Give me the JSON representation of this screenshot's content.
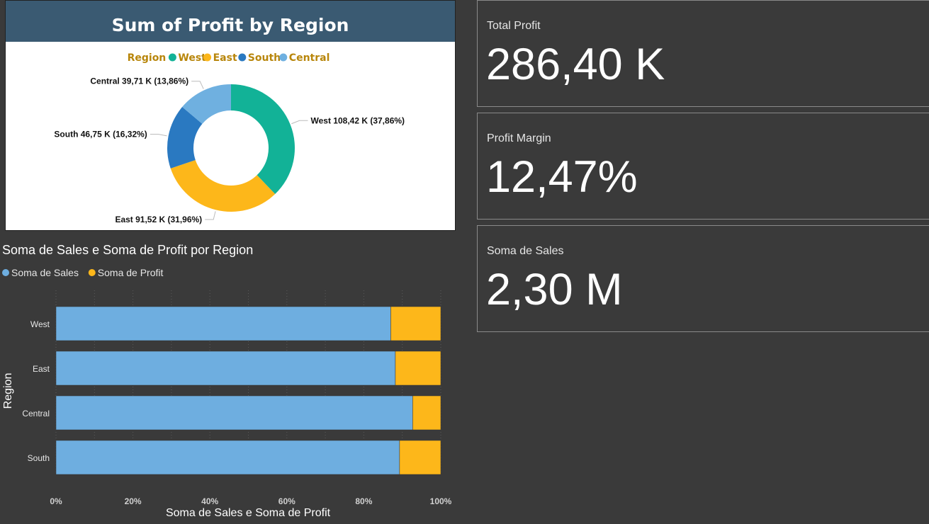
{
  "donut": {
    "title": "Sum of Profit by Region",
    "legend_title": "Region",
    "colors": {
      "title_bar": "#3a5a72",
      "legend_text": "#b8860b"
    }
  },
  "bar": {
    "title": "Soma de Sales e Soma de Profit por Region",
    "xlabel": "Soma de Sales e Soma de Profit",
    "ylabel": "Region"
  },
  "kpis": [
    {
      "label": "Total Profit",
      "value": "286,40 K"
    },
    {
      "label": "Profit Margin",
      "value": "12,47%"
    },
    {
      "label": "Soma de Sales",
      "value": "2,30 M"
    }
  ],
  "chart_data": [
    {
      "type": "pie",
      "title": "Sum of Profit by Region",
      "legend_title": "Region",
      "legend_position": "top",
      "donut": true,
      "categories": [
        "West",
        "East",
        "South",
        "Central"
      ],
      "values": [
        108.42,
        91.52,
        46.75,
        39.71
      ],
      "percents": [
        37.86,
        31.96,
        16.32,
        13.86
      ],
      "data_labels": [
        "West 108,42 K (37,86%)",
        "East 91,52 K (31,96%)",
        "South 46,75 K (16,32%)",
        "Central 39,71 K (13,86%)"
      ],
      "colors": [
        "#12b297",
        "#fdb71a",
        "#2a79c1",
        "#6fb0e0"
      ]
    },
    {
      "type": "bar",
      "orientation": "horizontal",
      "stacked": "100%",
      "title": "Soma de Sales e Soma de Profit por Region",
      "xlabel": "Soma de Sales e Soma de Profit",
      "ylabel": "Region",
      "categories": [
        "West",
        "East",
        "Central",
        "South"
      ],
      "series": [
        {
          "name": "Soma de Sales",
          "values": [
            87.0,
            88.2,
            92.7,
            89.3
          ],
          "color": "#6eaee0"
        },
        {
          "name": "Soma de Profit",
          "values": [
            13.0,
            11.8,
            7.3,
            10.7
          ],
          "color": "#fdb71a"
        }
      ],
      "xlim": [
        0,
        100
      ],
      "xticks": [
        "0%",
        "20%",
        "40%",
        "60%",
        "80%",
        "100%"
      ],
      "grid": true,
      "legend_position": "top-left"
    }
  ]
}
